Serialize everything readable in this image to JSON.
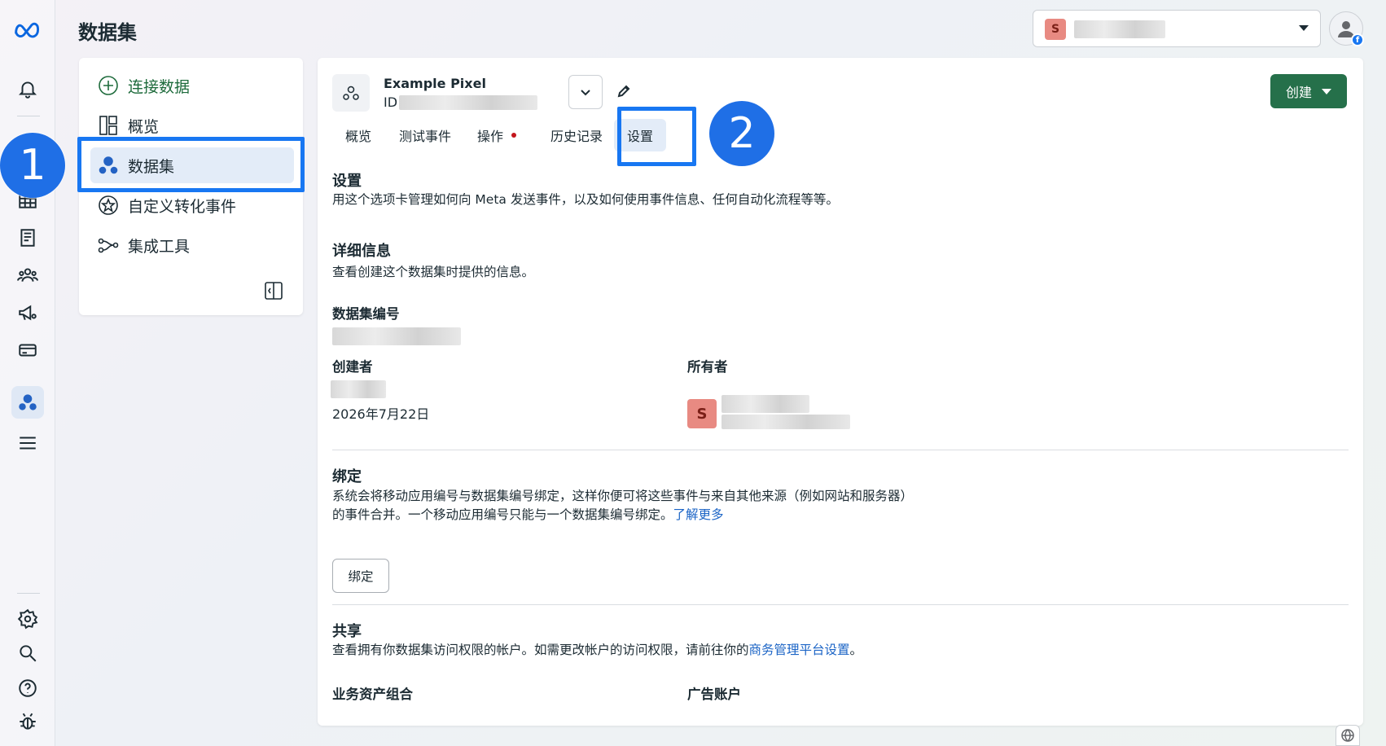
{
  "header": {
    "title": "数据集",
    "account_initial": "S"
  },
  "rail": {
    "icons": [
      "meta-logo-icon",
      "bell-icon",
      "grid-icon",
      "catalog-icon",
      "people-icon",
      "megaphone-icon",
      "card-icon",
      "dataset-icon",
      "menu-icon",
      "settings-icon",
      "search-icon",
      "help-icon",
      "bug-icon"
    ]
  },
  "sidebar": {
    "items": [
      {
        "label": "连接数据"
      },
      {
        "label": "概览"
      },
      {
        "label": "数据集"
      },
      {
        "label": "自定义转化事件"
      },
      {
        "label": "集成工具"
      }
    ]
  },
  "pixel": {
    "name": "Example Pixel",
    "id_label": "ID"
  },
  "tabs": [
    {
      "label": "概览"
    },
    {
      "label": "测试事件"
    },
    {
      "label": "操作"
    },
    {
      "label": "历史记录"
    },
    {
      "label": "设置"
    }
  ],
  "create_button": "创建",
  "settings": {
    "title": "设置",
    "desc": "用这个选项卡管理如何向 Meta 发送事件，以及如何使用事件信息、任何自动化流程等等。"
  },
  "details": {
    "title": "详细信息",
    "desc": "查看创建这个数据集时提供的信息。",
    "dataset_id_label": "数据集编号",
    "creator_label": "创建者",
    "created_date": "2026年7月22日",
    "owner_label": "所有者",
    "owner_initial": "S"
  },
  "binding": {
    "title": "绑定",
    "desc_line1": "系统会将移动应用编号与数据集编号绑定，这样你便可将这些事件与来自其他来源（例如网站和服务器）",
    "desc_line2": "的事件合并。一个移动应用编号只能与一个数据集编号绑定。",
    "learn_more": "了解更多",
    "button": "绑定"
  },
  "sharing": {
    "title": "共享",
    "desc": "查看拥有你数据集访问权限的帐户。如需更改帐户的访问权限，请前往你的",
    "link": "商务管理平台设置",
    "desc_end": "。",
    "col1": "业务资产组合",
    "col2": "广告账户"
  },
  "annotations": {
    "step1": "1",
    "step2": "2"
  },
  "colors": {
    "accent": "#1877f2",
    "primary_green": "#25704a",
    "link": "#1b64c6",
    "active_bg": "#e3ecf8"
  }
}
